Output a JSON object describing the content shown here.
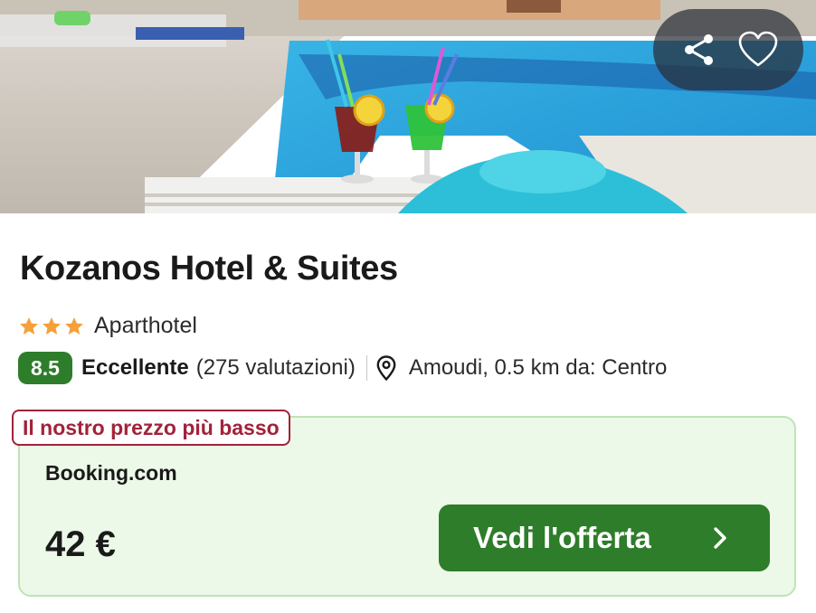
{
  "hotel": {
    "name": "Kozanos Hotel & Suites",
    "stars": 3,
    "type": "Aparthotel",
    "score": "8.5",
    "rating_label": "Eccellente",
    "rating_count": "(275 valutazioni)",
    "location": "Amoudi, 0.5 km da: Centro"
  },
  "actions": {
    "share_icon": "share-icon",
    "favorite_icon": "heart-icon"
  },
  "offer": {
    "badge": "Il nostro prezzo più basso",
    "provider": "Booking.com",
    "price": "42 €",
    "cta_label": "Vedi l'offerta"
  },
  "colors": {
    "brand_green": "#2e7d2a",
    "badge_red": "#a1233a",
    "offer_bg": "#ecf8e8",
    "star_orange": "#f5a03a"
  }
}
